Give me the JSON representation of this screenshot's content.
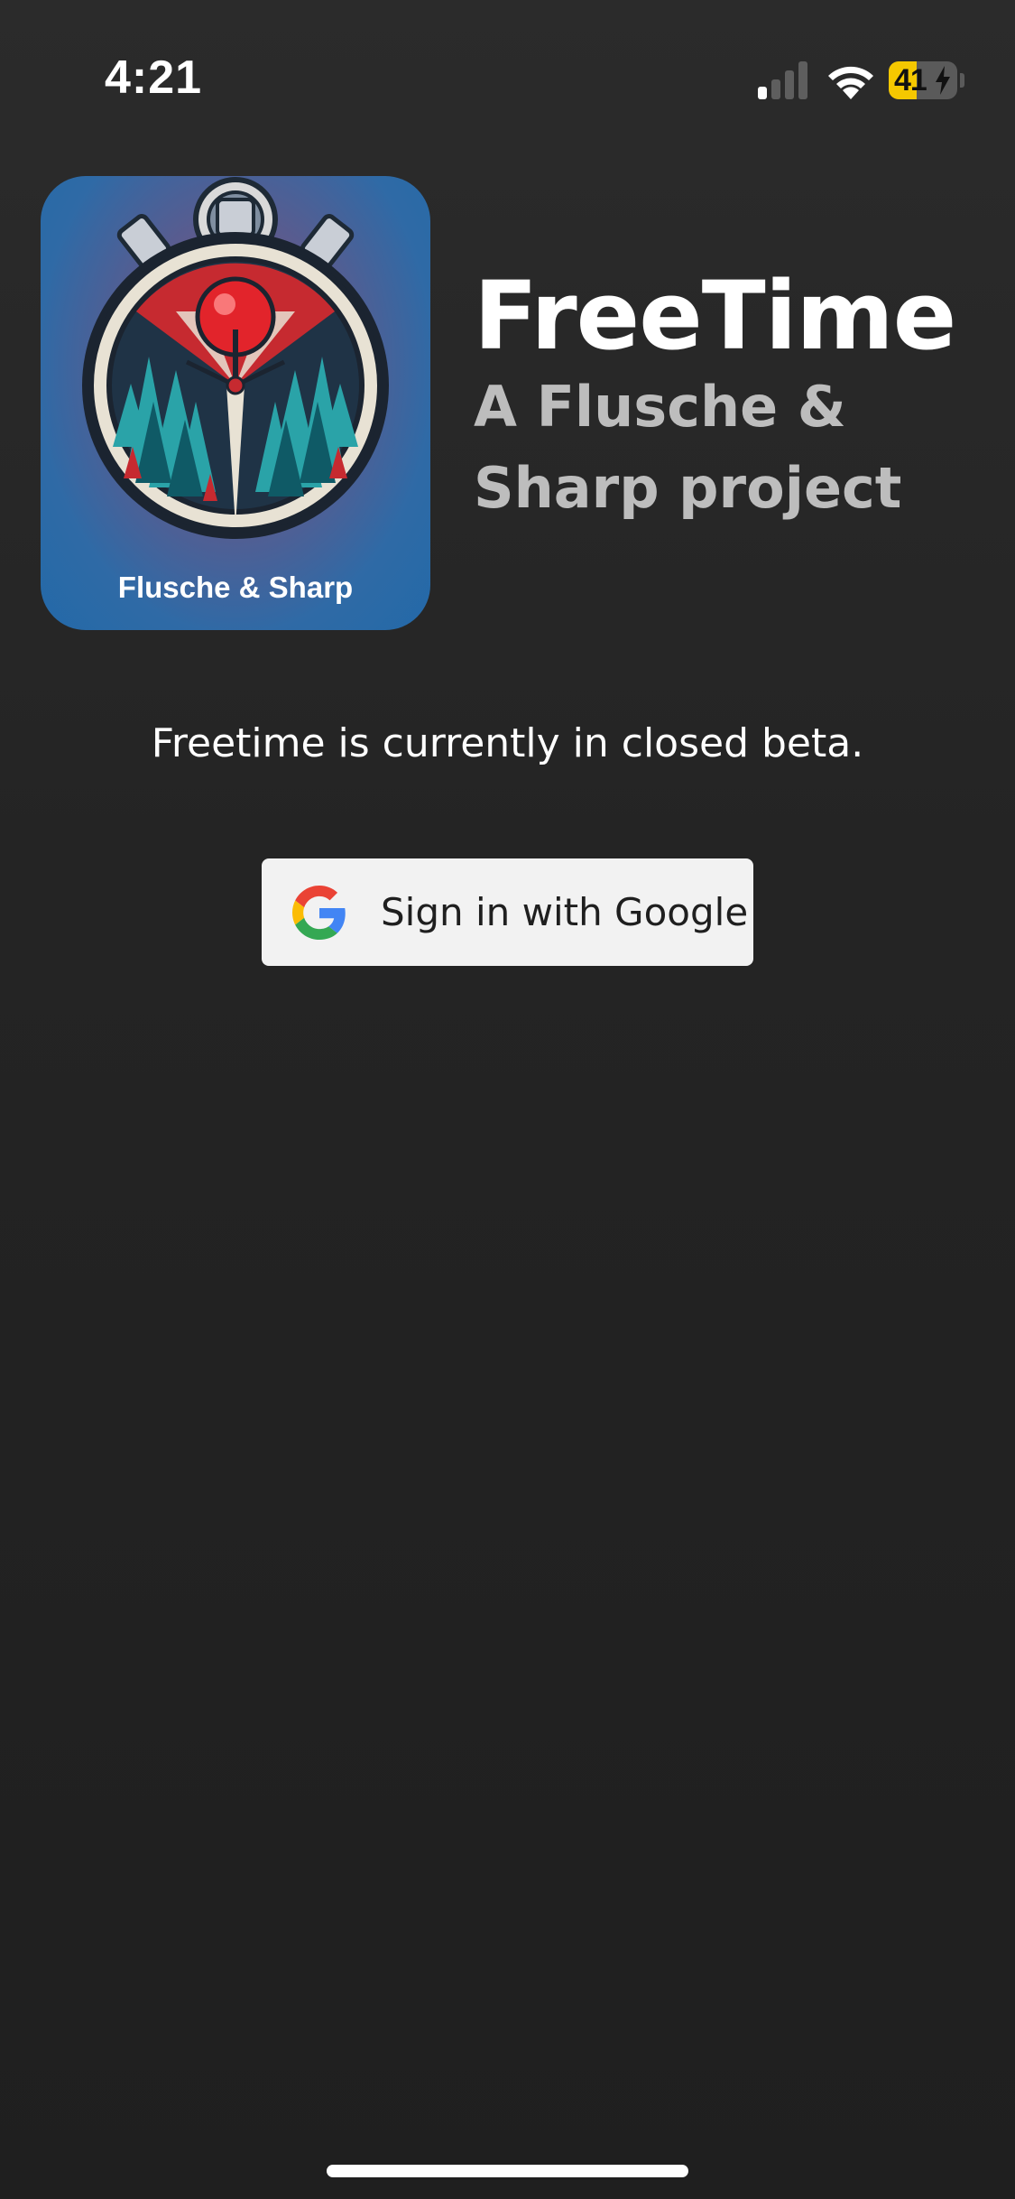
{
  "status_bar": {
    "time": "4:21",
    "signal_icon": "cellular-signal-icon",
    "signal_bars_active": 1,
    "signal_bars_total": 4,
    "wifi_icon": "wifi-icon",
    "battery_icon": "battery-charging-icon",
    "battery_level": "41",
    "battery_fraction": 0.41,
    "battery_color": "#f5c800"
  },
  "header": {
    "logo_icon": "stopwatch-forest-logo",
    "logo_caption": "Flusche & Sharp",
    "title": "FreeTime",
    "subtitle_line1": "A Flusche &",
    "subtitle_line2": "Sharp project"
  },
  "main": {
    "beta_notice": "Freetime is currently in closed beta.",
    "google_button": {
      "label": "Sign in with Google",
      "icon": "google-g-icon",
      "background": "#f2f2f2"
    }
  },
  "colors": {
    "background": "#242424",
    "subtitle": "#bdbdbd",
    "text": "#ffffff"
  }
}
